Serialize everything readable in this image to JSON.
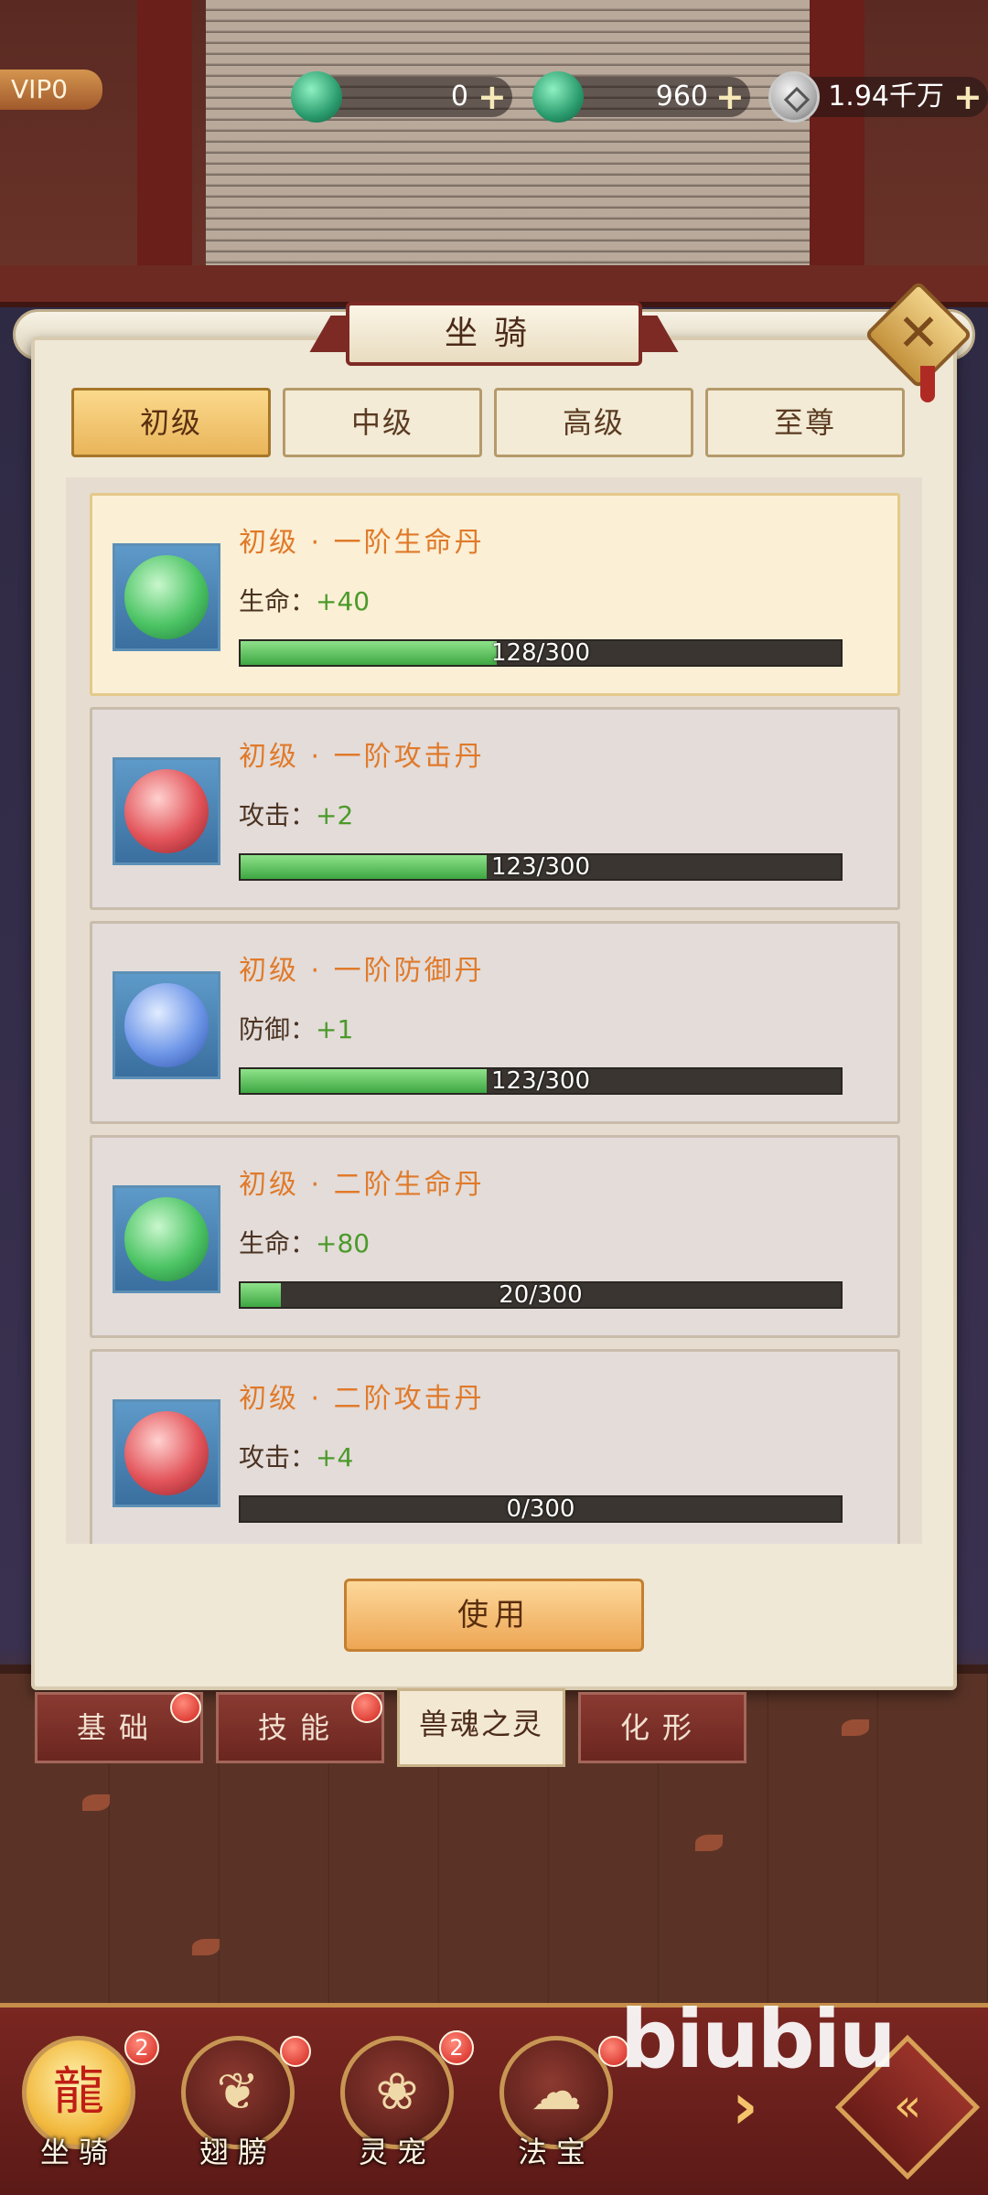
{
  "top_bar": {
    "vip": "VIP0",
    "currencies": [
      {
        "icon": "jade-dragon-icon",
        "value": "0"
      },
      {
        "icon": "locked-jade-dragon-icon",
        "value": "960"
      },
      {
        "icon": "silver-coin-icon",
        "value": "1.94千万"
      }
    ],
    "plus": "+"
  },
  "panel": {
    "title": "坐骑",
    "close": "✕",
    "tabs": [
      "初级",
      "中级",
      "高级",
      "至尊"
    ],
    "active_tab": 0,
    "items": [
      {
        "name": "初级 · 一阶生命丹",
        "stat_label": "生命：",
        "stat_value": "+40",
        "progress": 128,
        "max": 300,
        "progress_text": "128/300",
        "orb": "green"
      },
      {
        "name": "初级 · 一阶攻击丹",
        "stat_label": "攻击：",
        "stat_value": "+2",
        "progress": 123,
        "max": 300,
        "progress_text": "123/300",
        "orb": "red"
      },
      {
        "name": "初级 · 一阶防御丹",
        "stat_label": "防御：",
        "stat_value": "+1",
        "progress": 123,
        "max": 300,
        "progress_text": "123/300",
        "orb": "blue"
      },
      {
        "name": "初级 · 二阶生命丹",
        "stat_label": "生命：",
        "stat_value": "+80",
        "progress": 20,
        "max": 300,
        "progress_text": "20/300",
        "orb": "green"
      },
      {
        "name": "初级 · 二阶攻击丹",
        "stat_label": "攻击：",
        "stat_value": "+4",
        "progress": 0,
        "max": 300,
        "progress_text": "0/300",
        "orb": "red"
      }
    ],
    "use_button": "使用"
  },
  "sub_tabs": [
    {
      "label": "基础",
      "dot": true
    },
    {
      "label": "技能",
      "dot": true
    },
    {
      "label": "兽魂之灵",
      "dot": false,
      "active": true
    },
    {
      "label": "化形",
      "dot": false
    }
  ],
  "bottom_nav": [
    {
      "label": "坐骑",
      "badge": "2",
      "icon": "mount-dragon-icon",
      "active": true
    },
    {
      "label": "翅膀",
      "badge": "",
      "dot": true,
      "icon": "wing-icon"
    },
    {
      "label": "灵宠",
      "badge": "2",
      "icon": "pet-cat-icon"
    },
    {
      "label": "法宝",
      "badge": "",
      "dot": true,
      "icon": "treasure-gourd-icon"
    }
  ],
  "watermark": "biubiu",
  "colors": {
    "accent": "#e07a2a",
    "progress": "#3da742",
    "brand": "#7d2a24"
  }
}
